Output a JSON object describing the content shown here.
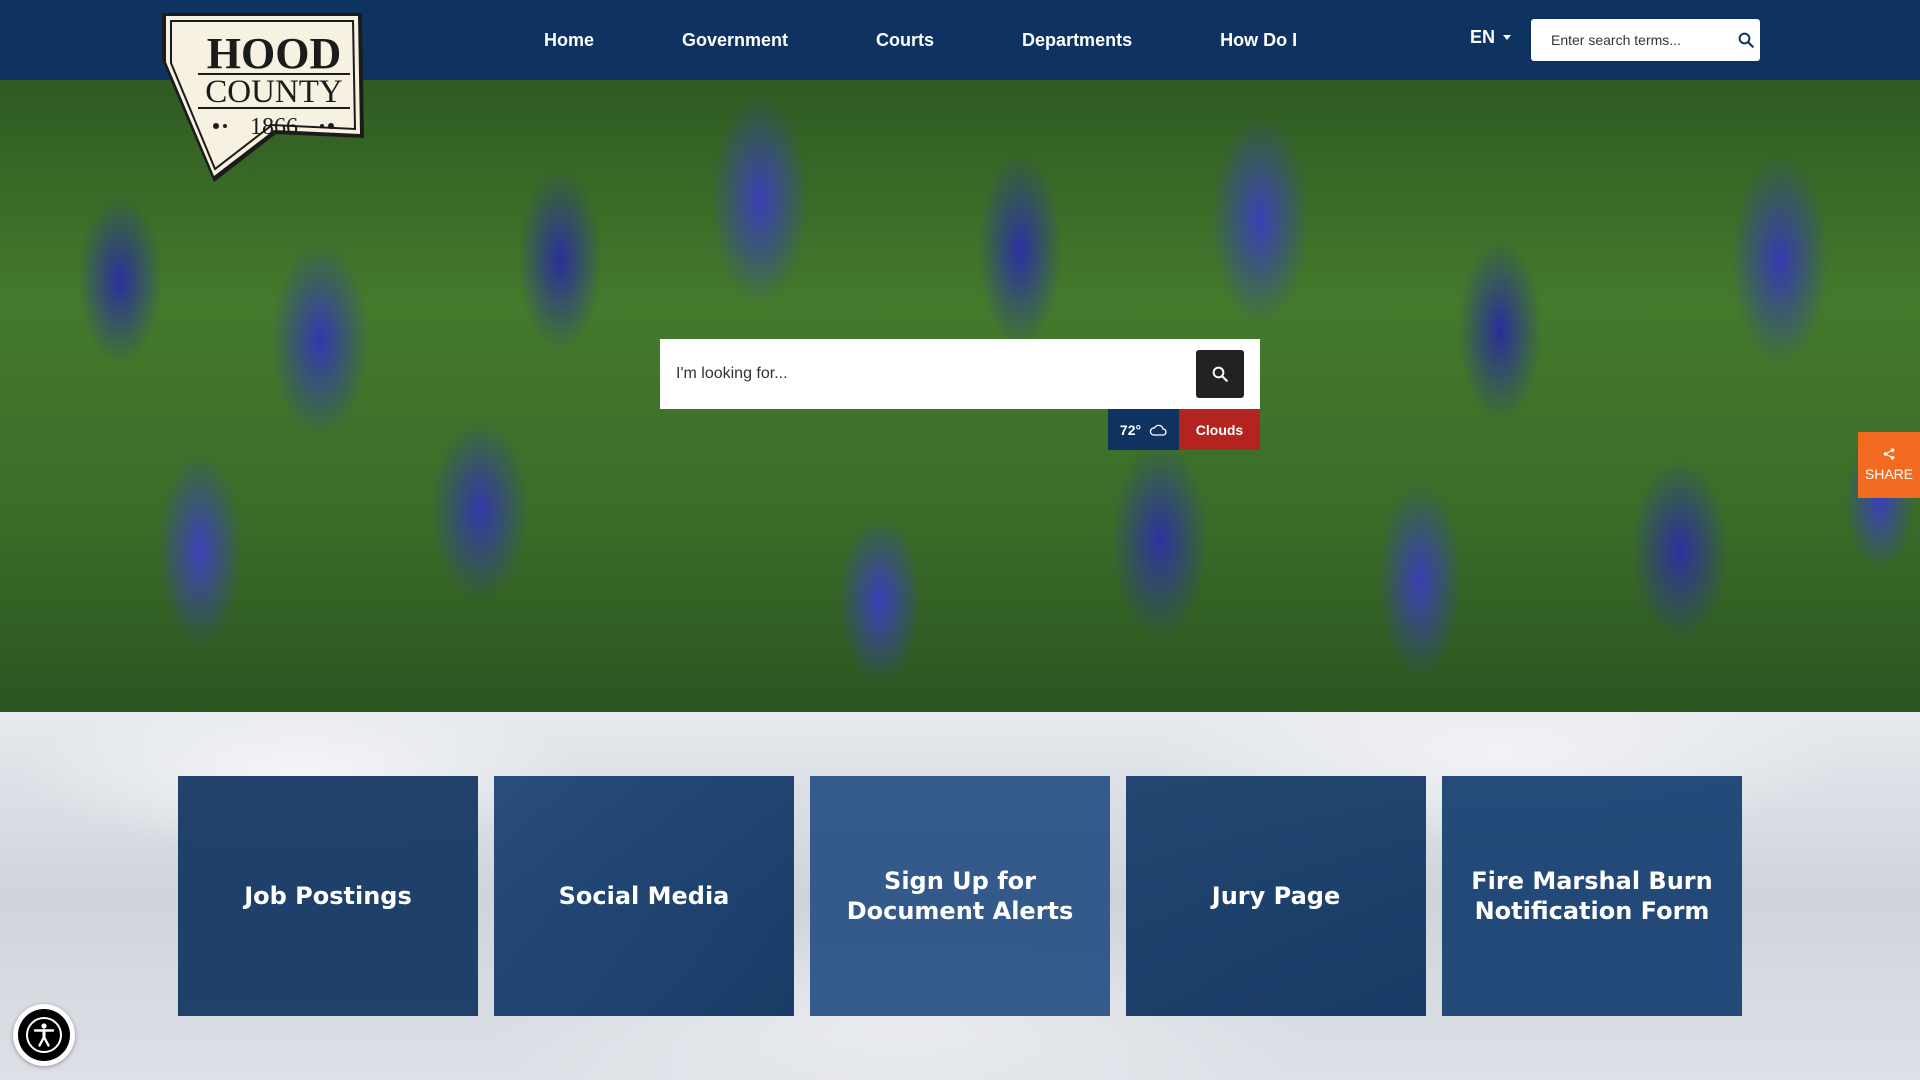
{
  "logo": {
    "line1": "HOOD",
    "line2": "COUNTY",
    "year": "1866"
  },
  "nav": {
    "items": [
      {
        "label": "Home"
      },
      {
        "label": "Government"
      },
      {
        "label": "Courts"
      },
      {
        "label": "Departments"
      },
      {
        "label": "How Do I"
      }
    ],
    "language": "EN",
    "search_placeholder": "Enter search terms..."
  },
  "hero": {
    "search_placeholder": "I'm looking for...",
    "weather": {
      "temperature": "72°",
      "condition": "Clouds",
      "icon": "cloud-icon"
    }
  },
  "share": {
    "label": "SHARE",
    "icon": "share-icon"
  },
  "tiles": [
    {
      "label": "Job Postings"
    },
    {
      "label": "Social Media"
    },
    {
      "label": "Sign Up for Document Alerts"
    },
    {
      "label": "Jury Page"
    },
    {
      "label": "Fire Marshal Burn Notification Form"
    }
  ],
  "colors": {
    "brand_navy": "#0f3360",
    "accent_red": "#b3231f",
    "share_orange": "#f26b21"
  },
  "accessibility": {
    "icon": "accessibility-icon"
  }
}
